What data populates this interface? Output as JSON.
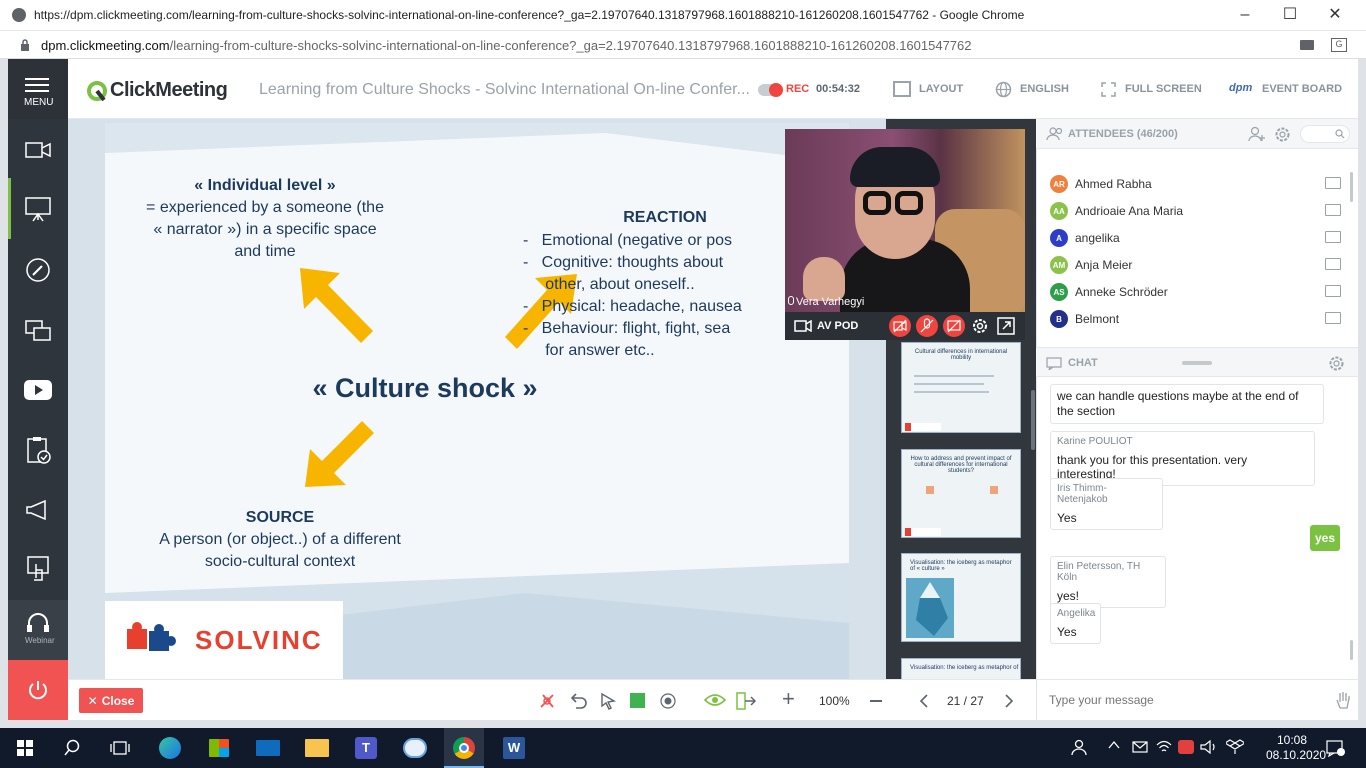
{
  "browser": {
    "window_title": "https://dpm.clickmeeting.com/learning-from-culture-shocks-solvinc-international-on-line-conference?_ga=2.19707640.1318797968.1601888210-161260208.1601547762 - Google Chrome",
    "address_domain": "dpm.clickmeeting.com",
    "address_path": "/learning-from-culture-shocks-solvinc-international-on-line-conference?_ga=2.19707640.1318797968.1601888210-161260208.1601547762"
  },
  "header": {
    "menu_label": "MENU",
    "logo_text": "ClickMeeting",
    "event_title": "Learning from Culture Shocks - Solvinc International On-line Confer...",
    "rec_label": "REC",
    "rec_time": "00:54:32",
    "layout_label": "LAYOUT",
    "language_label": "ENGLISH",
    "fullscreen_label": "FULL SCREEN",
    "event_board_label": "EVENT BOARD",
    "dpm_logo": "dpm"
  },
  "sidebar": {
    "webinar_label": "Webinar"
  },
  "slide": {
    "individual_title": "« Individual level »",
    "individual_text": [
      "= experienced by a someone (the",
      "« narrator »)  in a specific space",
      "and time"
    ],
    "reaction_title": "REACTION",
    "reaction_items": [
      "-   Emotional (negative or pos",
      "-   Cognitive: thoughts about",
      "     other, about oneself..",
      "-   Physical: headache, nausea",
      "-   Behaviour: flight, fight, sea",
      "     for answer etc.."
    ],
    "center_title": "« Culture shock »",
    "source_title": "SOURCE",
    "source_text": [
      "A person (or object..) of a different",
      "socio-cultural context"
    ],
    "logo_text": "SOLVINC"
  },
  "video": {
    "presenter_name": "Vera Varhegyi",
    "av_pod_label": "AV POD"
  },
  "thumbnails": [
    {
      "title": "Cultural differences in international mobility"
    },
    {
      "title": "How to address and prevent impact of cultural differences for international students?"
    },
    {
      "title": "Visualisation: the iceberg as metaphor of « culture »"
    },
    {
      "title": "Visualisation: the iceberg as metaphor of « culture »"
    }
  ],
  "attendees": {
    "header": "ATTENDEES (46/200)",
    "list": [
      {
        "initials": "AR",
        "name": "Ahmed Rabha",
        "color": "#f0803c"
      },
      {
        "initials": "AA",
        "name": "Andrioaie Ana Maria",
        "color": "#8bc34a"
      },
      {
        "initials": "A",
        "name": "angelika",
        "color": "#2c3ec8"
      },
      {
        "initials": "AM",
        "name": "Anja Meier",
        "color": "#8bc34a"
      },
      {
        "initials": "AS",
        "name": "Anneke Schröder",
        "color": "#2e9e4a"
      },
      {
        "initials": "B",
        "name": "Belmont",
        "color": "#23308a"
      }
    ]
  },
  "chat": {
    "header": "CHAT",
    "messages": [
      {
        "name": "",
        "text": "we can handle questions maybe at the end of the section"
      },
      {
        "name": "Karine POULIOT",
        "text": "thank you for this presentation. very interesting!"
      },
      {
        "name": "Iris Thimm-Netenjakob",
        "text": "Yes"
      },
      {
        "name": "",
        "text": "yes"
      },
      {
        "name": "Elin Petersson, TH Köln",
        "text": "yes!"
      },
      {
        "name": "Angelika",
        "text": "Yes"
      }
    ],
    "input_placeholder": "Type your message"
  },
  "toolbar": {
    "close_label": "Close",
    "zoom": "100%",
    "page": "21 / 27"
  },
  "taskbar": {
    "time": "10:08",
    "date": "08.10.2020"
  },
  "colors": {
    "accent_green": "#7cc242",
    "rec_red": "#f0453f",
    "close_red": "#f05352",
    "arrow_yellow": "#f7b500",
    "slide_navy": "#1c3a5c"
  }
}
